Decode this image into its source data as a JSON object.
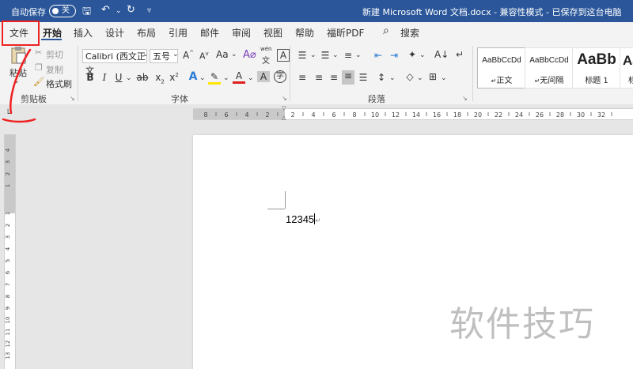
{
  "titlebar": {
    "autosave_label": "自动保存",
    "autosave_state": "关",
    "document_title": "新建 Microsoft Word 文档.docx - 兼容性模式 - 已保存到这台电脑"
  },
  "tabs": [
    {
      "label": "文件"
    },
    {
      "label": "开始"
    },
    {
      "label": "插入"
    },
    {
      "label": "设计"
    },
    {
      "label": "布局"
    },
    {
      "label": "引用"
    },
    {
      "label": "邮件"
    },
    {
      "label": "审阅"
    },
    {
      "label": "视图"
    },
    {
      "label": "帮助"
    },
    {
      "label": "福昕PDF"
    }
  ],
  "search_label": "搜索",
  "clipboard": {
    "paste_label": "粘贴",
    "cut_label": "剪切",
    "copy_label": "复制",
    "format_painter_label": "格式刷",
    "group_label": "剪贴板"
  },
  "font": {
    "font_name": "Calibri (西文正文",
    "font_size": "五号",
    "group_label": "字体",
    "phonetic_top": "wén",
    "phonetic_bottom": "文"
  },
  "paragraph": {
    "group_label": "段落"
  },
  "styles": [
    {
      "preview": "AaBbCcDd",
      "name": "正文"
    },
    {
      "preview": "AaBbCcDd",
      "name": "无间隔"
    },
    {
      "preview": "AaBb",
      "name": "标题 1"
    },
    {
      "preview": "AaB",
      "name": "标"
    }
  ],
  "hruler_ticks": [
    "8",
    "6",
    "4",
    "2",
    "2",
    "4",
    "6",
    "8",
    "10",
    "12",
    "14",
    "16",
    "18",
    "20",
    "22",
    "24",
    "26",
    "28",
    "30",
    "32"
  ],
  "vruler_ticks": [
    "4",
    "3",
    "2",
    "1",
    "1",
    "2",
    "3",
    "4",
    "5",
    "6",
    "7",
    "8",
    "9",
    "10",
    "11",
    "12",
    "13",
    "14",
    "15",
    "16"
  ],
  "document": {
    "text": "12345"
  },
  "watermark": "软件技巧",
  "colors": {
    "titlebar": "#2b579a",
    "annotation": "#e22222"
  }
}
